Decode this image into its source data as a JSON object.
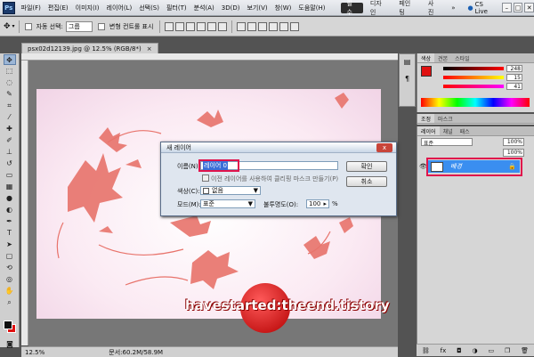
{
  "menubar": {
    "logo": "Ps",
    "items": [
      "파일(F)",
      "편집(E)",
      "이미지(I)",
      "레이어(L)",
      "선택(S)",
      "필터(T)",
      "분석(A)",
      "3D(D)",
      "보기(V)",
      "창(W)",
      "도움말(H)"
    ],
    "workspaces": [
      "필수",
      "디자인",
      "페인팅",
      "사진"
    ],
    "more": "»",
    "cslive": "CS Live",
    "win_min": "–",
    "win_max": "□",
    "win_close": "✕"
  },
  "optbar": {
    "auto_select_label": "자동 선택:",
    "auto_select_value": "그룹",
    "show_transform_label": "변형 컨트롤 표시"
  },
  "document": {
    "tab_title": "psx02d12139.jpg @ 12.5% (RGB/8*)",
    "tab_close": "×",
    "zoom": "12.5%",
    "doc_info": "문서:60.2M/58.9M",
    "watermark": "havestarted:theend.tistory"
  },
  "dialog": {
    "title": "새 레이어",
    "close": "x",
    "name_label": "이름(N):",
    "name_value": "레이어 0",
    "clip_label": "이전 레이어를 사용하여 클리핑 마스크 만들기(P)",
    "color_label": "색상(C):",
    "color_value": "없음",
    "mode_label": "모드(M):",
    "mode_value": "표준",
    "opacity_label": "불투명도(O):",
    "opacity_value": "100",
    "opacity_unit": "%",
    "ok": "확인",
    "cancel": "취소"
  },
  "panels": {
    "color_tabs": [
      "색상",
      "견본",
      "스타일"
    ],
    "color_values": [
      "248",
      "15",
      "41"
    ],
    "adjust_tabs": [
      "조정",
      "마스크"
    ],
    "layer_tabs": [
      "레이어",
      "채널",
      "패스"
    ],
    "blend_mode": "표준",
    "opacity": "100%",
    "fill": "100%",
    "layer_name": "배경"
  },
  "colors": {
    "accent": "#e0144c",
    "layer_selected": "#3a8ef0",
    "leaf": "#e8736b",
    "fg_swatch": "#e01010"
  }
}
